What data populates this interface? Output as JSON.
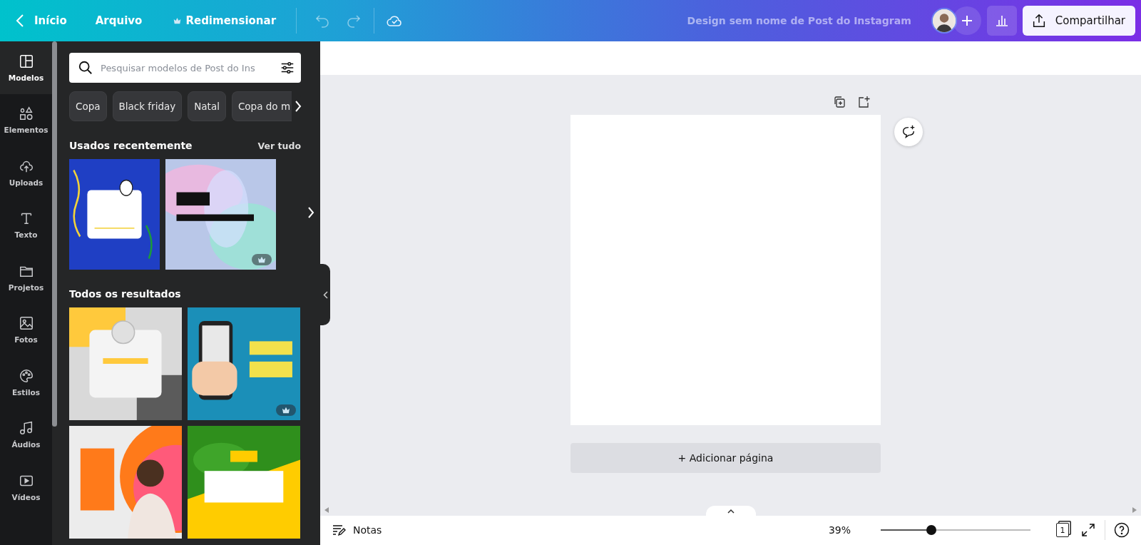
{
  "topbar": {
    "back": "Início",
    "menu": [
      {
        "label": "Arquivo",
        "premium": false
      },
      {
        "label": "Redimensionar",
        "premium": true
      }
    ],
    "title": "Design sem nome de Post do Instagram",
    "share": "Compartilhar"
  },
  "rail": [
    {
      "label": "Modelos",
      "selected": true
    },
    {
      "label": "Elementos",
      "selected": false
    },
    {
      "label": "Uploads",
      "selected": false
    },
    {
      "label": "Texto",
      "selected": false
    },
    {
      "label": "Projetos",
      "selected": false
    },
    {
      "label": "Fotos",
      "selected": false
    },
    {
      "label": "Estilos",
      "selected": false
    },
    {
      "label": "Áudios",
      "selected": false
    },
    {
      "label": "Vídeos",
      "selected": false
    }
  ],
  "panel": {
    "search": {
      "placeholder": "Pesquisar modelos de Post do Ins"
    },
    "chips": [
      "Copa",
      "Black friday",
      "Natal",
      "Copa do m"
    ],
    "recent": {
      "title": "Usados recentemente",
      "see_all": "Ver tudo",
      "templates": [
        {
          "kind": "picture",
          "premium": false
        },
        {
          "kind": "picture",
          "premium": true
        }
      ]
    },
    "results": {
      "title": "Todos os resultados",
      "templates": [
        {
          "kind": "picture",
          "premium": false
        },
        {
          "kind": "picture",
          "premium": true
        },
        {
          "kind": "picture",
          "premium": false
        },
        {
          "kind": "picture",
          "premium": false
        }
      ]
    }
  },
  "canvas": {
    "add_page": "+ Adicionar página"
  },
  "footer": {
    "notes": "Notas",
    "zoom": "39%",
    "level": 0.34,
    "page_count": "1"
  }
}
